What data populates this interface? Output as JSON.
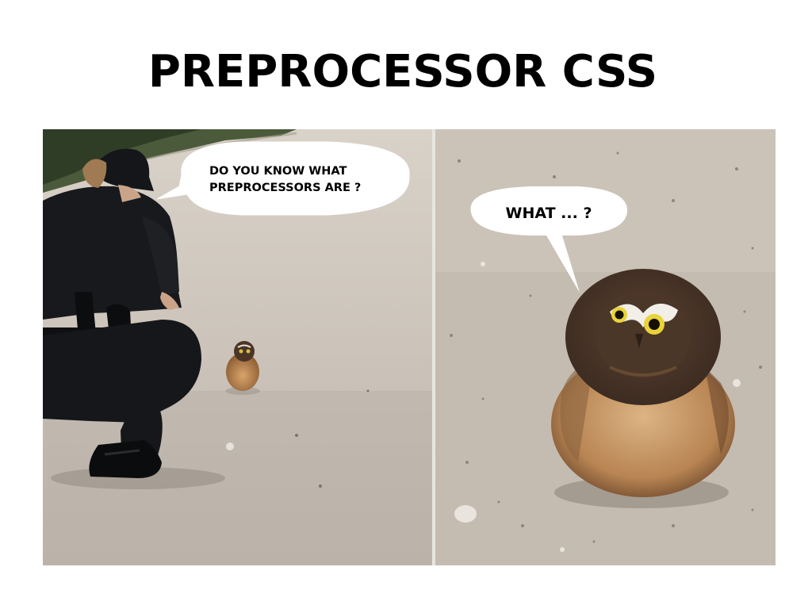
{
  "slide": {
    "title": "PREPROCESSOR CSS"
  },
  "panels": {
    "left": {
      "speech": "DO YOU KNOW WHAT\nPREPROCESSORS ARE ?"
    },
    "right": {
      "speech": "WHAT ... ?"
    }
  }
}
